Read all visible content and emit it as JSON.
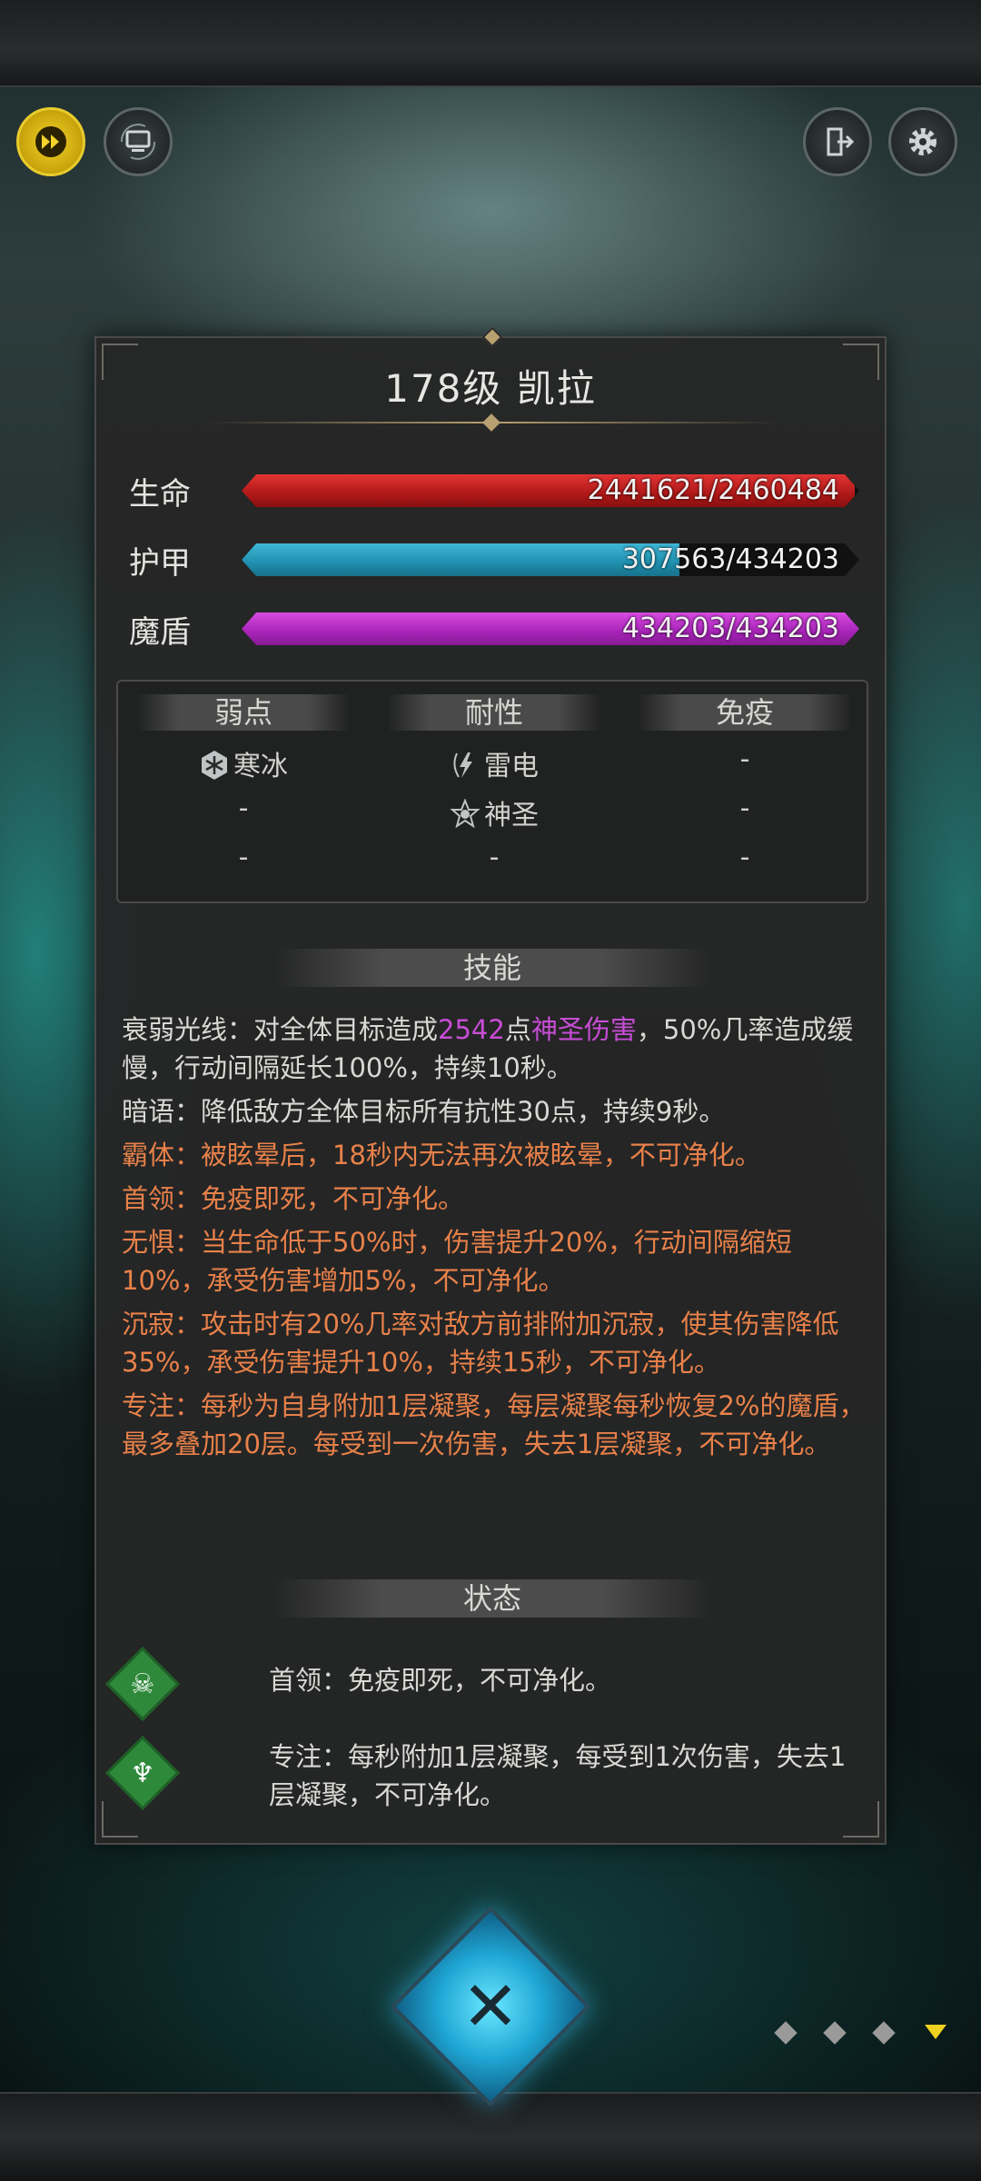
{
  "colors": {
    "hp": "#c82020",
    "armor": "#2aa6c6",
    "shield": "#b32fc4",
    "orange_text": "#e8814a",
    "purple_text": "#c84dd6",
    "speed_button": "#e8c41c",
    "status_green": "#2e8a3a"
  },
  "top": {
    "speed_icon": "fast-forward-icon",
    "auto_icon": "auto-battle-icon",
    "exit_icon": "exit-icon",
    "settings_icon": "gear-icon"
  },
  "panel": {
    "title": "178级  凯拉",
    "stats": [
      {
        "label": "生命",
        "text": "2441621/2460484",
        "current": 2441621,
        "max": 2460484
      },
      {
        "label": "护甲",
        "text": "307563/434203",
        "current": 307563,
        "max": 434203
      },
      {
        "label": "魔盾",
        "text": "434203/434203",
        "current": 434203,
        "max": 434203
      }
    ],
    "resist": {
      "weak_header": "弱点",
      "resist_header": "耐性",
      "immune_header": "免疫",
      "weak": [
        "寒冰",
        "-",
        "-"
      ],
      "resist_vals": [
        "雷电",
        "神圣",
        "-"
      ],
      "immune": [
        "-",
        "-",
        "-"
      ],
      "icons": {
        "ice": "snowflake-icon",
        "thunder": "lightning-icon",
        "holy": "holy-icon"
      }
    },
    "skills_header": "技能",
    "skills": {
      "s1_name": "衰弱光线：",
      "s1_a": "对全体目标造成",
      "s1_num": "2542",
      "s1_b": "点",
      "s1_dmg": "神圣伤害",
      "s1_c": "，50%几率造成缓慢，行动间隔延长100%，持续10秒。",
      "s2": "暗语：降低敌方全体目标所有抗性30点，持续9秒。",
      "s3": "霸体：被眩晕后，18秒内无法再次被眩晕，不可净化。",
      "s4": "首领：免疫即死，不可净化。",
      "s5": "无惧：当生命低于50%时，伤害提升20%，行动间隔缩短10%，承受伤害增加5%，不可净化。",
      "s6": "沉寂：攻击时有20%几率对敌方前排附加沉寂，使其伤害降低35%，承受伤害提升10%，持续15秒，不可净化。",
      "s7": "专注：每秒为自身附加1层凝聚，每层凝聚每秒恢复2%的魔盾，最多叠加20层。每受到一次伤害，失去1层凝聚，不可净化。"
    },
    "status_header": "状态",
    "status": [
      {
        "icon": "skull-icon",
        "text": "首领：免疫即死，不可净化。"
      },
      {
        "icon": "chalice-icon",
        "text": "专注：每秒附加1层凝聚，每受到1次伤害，失去1层凝聚，不可净化。"
      }
    ]
  },
  "bottom": {
    "close_icon": "close-icon",
    "pager_count": 4,
    "pager_active": 4
  }
}
